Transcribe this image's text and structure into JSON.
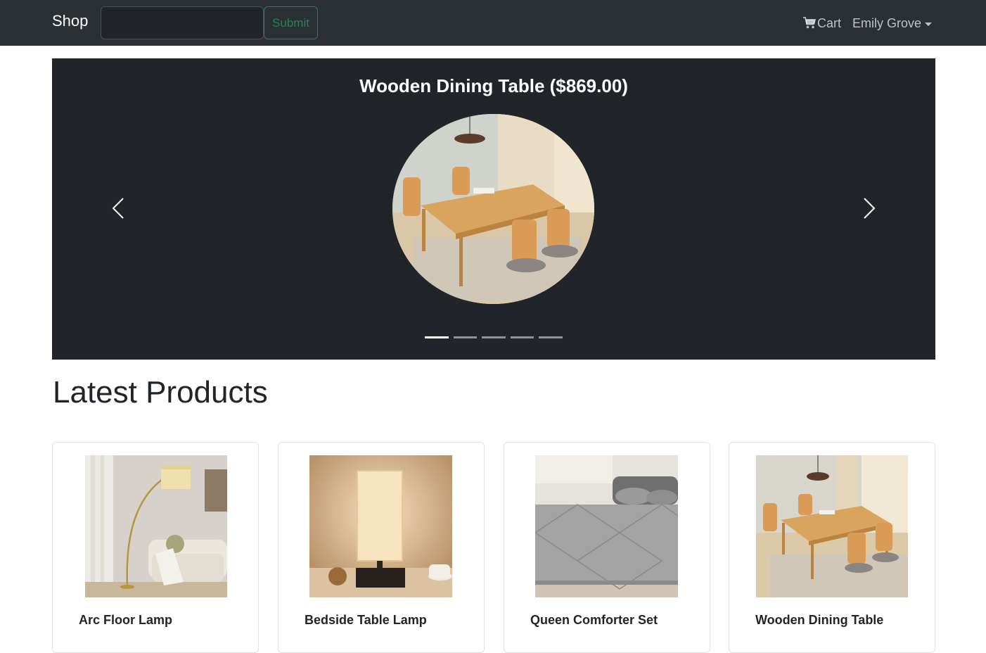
{
  "navbar": {
    "brand": "Shop",
    "search": {
      "value": "",
      "placeholder": ""
    },
    "submit_label": "Submit",
    "cart_label": "Cart",
    "user_name": "Emily Grove"
  },
  "carousel": {
    "caption": "Wooden Dining Table ($869.00)",
    "slide_count": 5,
    "active_index": 0
  },
  "latest": {
    "title": "Latest Products",
    "products": [
      {
        "name": "Arc Floor Lamp"
      },
      {
        "name": "Bedside Table Lamp"
      },
      {
        "name": "Queen Comforter Set"
      },
      {
        "name": "Wooden Dining Table"
      }
    ]
  },
  "colors": {
    "navbar_bg": "#2b3035",
    "carousel_bg": "#212529",
    "submit_outline": "#198754"
  },
  "icons": {
    "cart": "cart-icon",
    "prev": "chevron-left-icon",
    "next": "chevron-right-icon",
    "dropdown": "caret-down-icon"
  }
}
